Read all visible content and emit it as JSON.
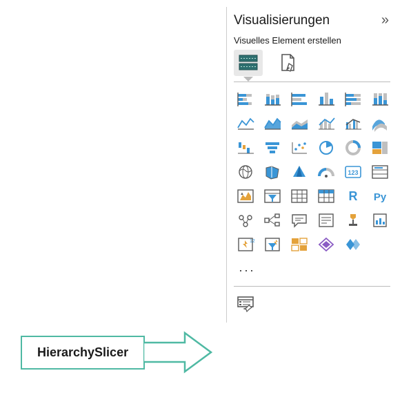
{
  "panel": {
    "title": "Visualisierungen",
    "subtitle": "Visuelles Element erstellen",
    "collapse": "»"
  },
  "modes": {
    "build": "Build visual",
    "format": "Format page"
  },
  "gallery": [
    {
      "name": "stacked-bar-chart-icon"
    },
    {
      "name": "stacked-column-chart-icon"
    },
    {
      "name": "clustered-bar-chart-icon"
    },
    {
      "name": "clustered-column-chart-icon"
    },
    {
      "name": "100pct-stacked-bar-chart-icon"
    },
    {
      "name": "100pct-stacked-column-chart-icon"
    },
    {
      "name": "line-chart-icon"
    },
    {
      "name": "area-chart-icon"
    },
    {
      "name": "stacked-area-chart-icon"
    },
    {
      "name": "line-stacked-column-icon"
    },
    {
      "name": "line-clustered-column-icon"
    },
    {
      "name": "ribbon-chart-icon"
    },
    {
      "name": "waterfall-chart-icon"
    },
    {
      "name": "funnel-chart-icon"
    },
    {
      "name": "scatter-chart-icon"
    },
    {
      "name": "pie-chart-icon"
    },
    {
      "name": "donut-chart-icon"
    },
    {
      "name": "treemap-icon"
    },
    {
      "name": "map-icon"
    },
    {
      "name": "filled-map-icon"
    },
    {
      "name": "azure-map-icon"
    },
    {
      "name": "gauge-icon"
    },
    {
      "name": "card-icon"
    },
    {
      "name": "multi-row-card-icon"
    },
    {
      "name": "kpi-icon"
    },
    {
      "name": "slicer-icon"
    },
    {
      "name": "table-icon"
    },
    {
      "name": "matrix-icon"
    },
    {
      "name": "r-visual-icon"
    },
    {
      "name": "python-visual-icon"
    },
    {
      "name": "key-influencers-icon"
    },
    {
      "name": "decomposition-tree-icon"
    },
    {
      "name": "qna-icon"
    },
    {
      "name": "smart-narrative-icon"
    },
    {
      "name": "goals-icon"
    },
    {
      "name": "paginated-report-icon"
    },
    {
      "name": "power-automate-icon"
    },
    {
      "name": "power-apps-icon"
    },
    {
      "name": "arcgis-icon"
    },
    {
      "name": "sharepoint-icon"
    },
    {
      "name": "custom-visual-icon"
    }
  ],
  "more": "···",
  "callout": {
    "label": "HierarchySlicer"
  },
  "custom_visual": {
    "name": "hierarchy-slicer-icon"
  },
  "colors": {
    "blue": "#3a95d6",
    "grey": "#595959",
    "lightgrey": "#bfbfbf",
    "orange": "#e4a23b",
    "red": "#d94f4f",
    "green": "#4fb9a3",
    "purple": "#8a5cc4"
  }
}
